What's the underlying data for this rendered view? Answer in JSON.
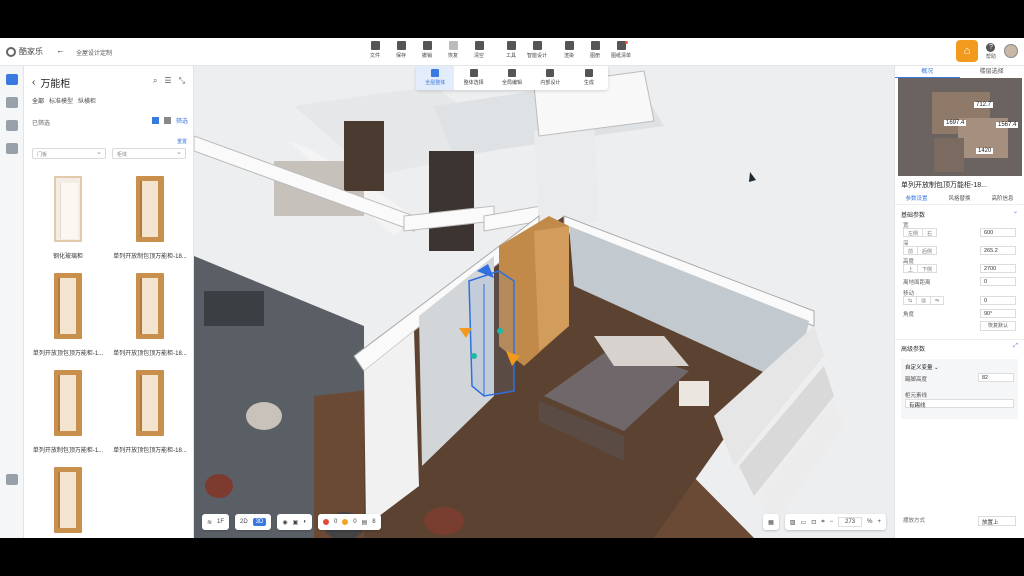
{
  "app": {
    "name": "酷家乐",
    "project": "全屋设计定制"
  },
  "toolbar": {
    "items": [
      {
        "label": "文件"
      },
      {
        "label": "保存"
      },
      {
        "label": "撤销"
      },
      {
        "label": "恢复"
      },
      {
        "label": "清空"
      },
      {
        "label": "工具"
      },
      {
        "label": "智能设计"
      },
      {
        "label": "渲染"
      },
      {
        "label": "图册"
      },
      {
        "label": "图纸清单"
      }
    ],
    "help": "帮助"
  },
  "subtoolbar": {
    "items": [
      {
        "label": "全屋整体"
      },
      {
        "label": "整体选择"
      },
      {
        "label": "全局编辑"
      },
      {
        "label": "内部设计"
      },
      {
        "label": "生成"
      }
    ]
  },
  "catalog": {
    "title": "万能柜",
    "tabs": [
      "全部",
      "标准模型",
      "纵横柜"
    ],
    "filter_label": "已筛选",
    "filter_link": "筛选",
    "reset": "重置",
    "select_1": "门板",
    "select_2": "柜体",
    "items": [
      {
        "label": "钢化玻璃柜",
        "style": "glass"
      },
      {
        "label": "单列开放制包顶万能柜-18...",
        "style": "wood"
      },
      {
        "label": "单列开放顶包顶万能柜-1...",
        "style": "wood"
      },
      {
        "label": "单列开放顶包顶万能柜-18...",
        "style": "wood"
      },
      {
        "label": "单列开放制包顶万能柜-1...",
        "style": "wood"
      },
      {
        "label": "单列开放顶包顶万能柜-18...",
        "style": "wood"
      },
      {
        "label": "",
        "style": "wood"
      }
    ]
  },
  "viewport": {
    "floor": "1F",
    "mode_2d": "2D",
    "mode_3d": "3D",
    "errors": "0",
    "warnings": "0",
    "notes": "8",
    "zoom": "273",
    "zoom_unit": "%"
  },
  "right_panel": {
    "tabs": [
      "概况",
      "楼层选择"
    ],
    "minimap_labels": [
      "712.7",
      "1697.4",
      "1567.4",
      "1420"
    ],
    "object_title": "单列开放制包顶万能柜-18...",
    "param_tabs": [
      "参数设置",
      "风格替换",
      "高阶信息"
    ],
    "section_basic": "基础参数",
    "width_label": "宽",
    "width_seg": [
      "左侧",
      "右"
    ],
    "width_value": "600",
    "depth_label": "深",
    "depth_seg": [
      "前",
      "后侧"
    ],
    "depth_value": "265.2",
    "height_label": "高度",
    "height_seg": [
      "上",
      "下侧"
    ],
    "height_value": "2700",
    "ground_label": "离地面距离",
    "ground_value": "0",
    "move_label": "移动",
    "move_value": "0",
    "rotate_label": "角度",
    "rotate_value": "90°",
    "restore": "恢复默认",
    "section_adv": "高级参数",
    "custom_title": "自定义变量",
    "custom_k1": "踢脚高度",
    "custom_v1": "82",
    "custom_k2": "柜元素线",
    "custom_v2": "有踢线",
    "mode_label": "摆放方式",
    "mode_value": "放置上"
  },
  "colors": {
    "accent": "#3a7ae0",
    "brand": "#f29a1e"
  }
}
